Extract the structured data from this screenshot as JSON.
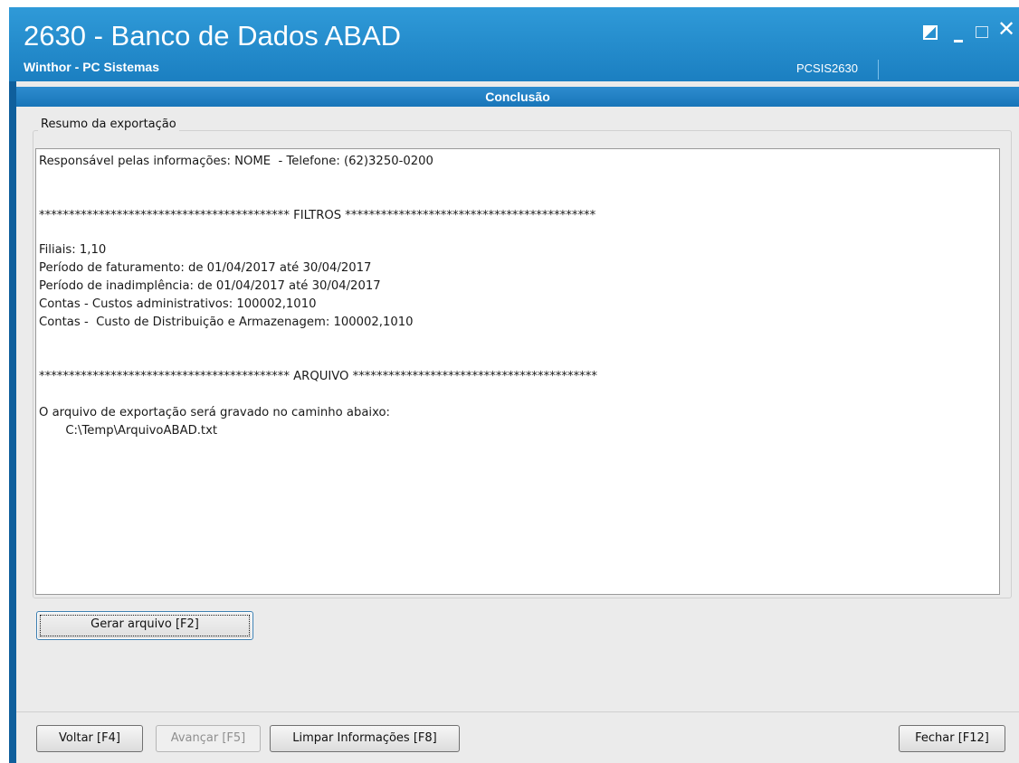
{
  "window": {
    "title": "2630 - Banco de Dados ABAD",
    "subtitle": "Winthor - PC Sistemas",
    "code": "PCSIS2630"
  },
  "step": {
    "title": "Conclusão"
  },
  "summary": {
    "group_label": "Resumo da exportação",
    "lines": [
      "Responsável pelas informações: NOME  - Telefone: (62)3250-0200",
      "****************************************** FILTROS ******************************************",
      "Filiais: 1,10",
      "Período de faturamento: de 01/04/2017 até 30/04/2017",
      "Período de inadimplência: de 01/04/2017 até 30/04/2017",
      "Contas - Custos administrativos: 100002,1010",
      "Contas -  Custo de Distribuição e Armazenagem: 100002,1010",
      "****************************************** ARQUIVO *****************************************",
      "O arquivo de exportação será gravado no caminho abaixo:",
      "       C:\\Temp\\ArquivoABAD.txt"
    ]
  },
  "buttons": {
    "generate": "Gerar arquivo [F2]",
    "back": "Voltar [F4]",
    "next": "Avançar [F5]",
    "clear": "Limpar Informações [F8]",
    "close": "Fechar [F12]"
  }
}
